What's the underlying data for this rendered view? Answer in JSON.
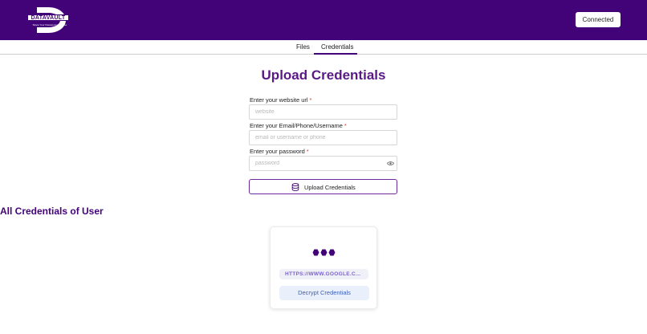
{
  "header": {
    "logo_text": "DATAVAULT",
    "logo_tagline": "Share Your Password with Ease",
    "connect_label": "Connected",
    "bg_color": "#420379"
  },
  "tabs": [
    {
      "label": "Files",
      "active": false
    },
    {
      "label": "Credentials",
      "active": true
    }
  ],
  "form": {
    "title": "Upload Credentials",
    "fields": [
      {
        "label": "Enter your website url",
        "required_mark": "*",
        "placeholder": "website",
        "value": ""
      },
      {
        "label": "Enter your Email/Phone/Username",
        "required_mark": "*",
        "placeholder": "email or username or phone",
        "value": ""
      },
      {
        "label": "Enter your password",
        "required_mark": "*",
        "placeholder": "password",
        "value": "",
        "icon": "eye-icon"
      }
    ],
    "submit_label": "Upload Credentials",
    "submit_icon": "database-icon"
  },
  "credentials_section": {
    "title": "All Credentials of User",
    "cards": [
      {
        "icon": "asterisks-icon",
        "url": "HTTPS://WWW.GOOGLE.C...",
        "action_label": "Decrypt Credentials"
      }
    ]
  },
  "colors": {
    "accent": "#420379",
    "title": "#5a1a86",
    "required": "#d23a3a",
    "url_text": "#7b63c9",
    "decrypt_text": "#3d5fb8"
  }
}
